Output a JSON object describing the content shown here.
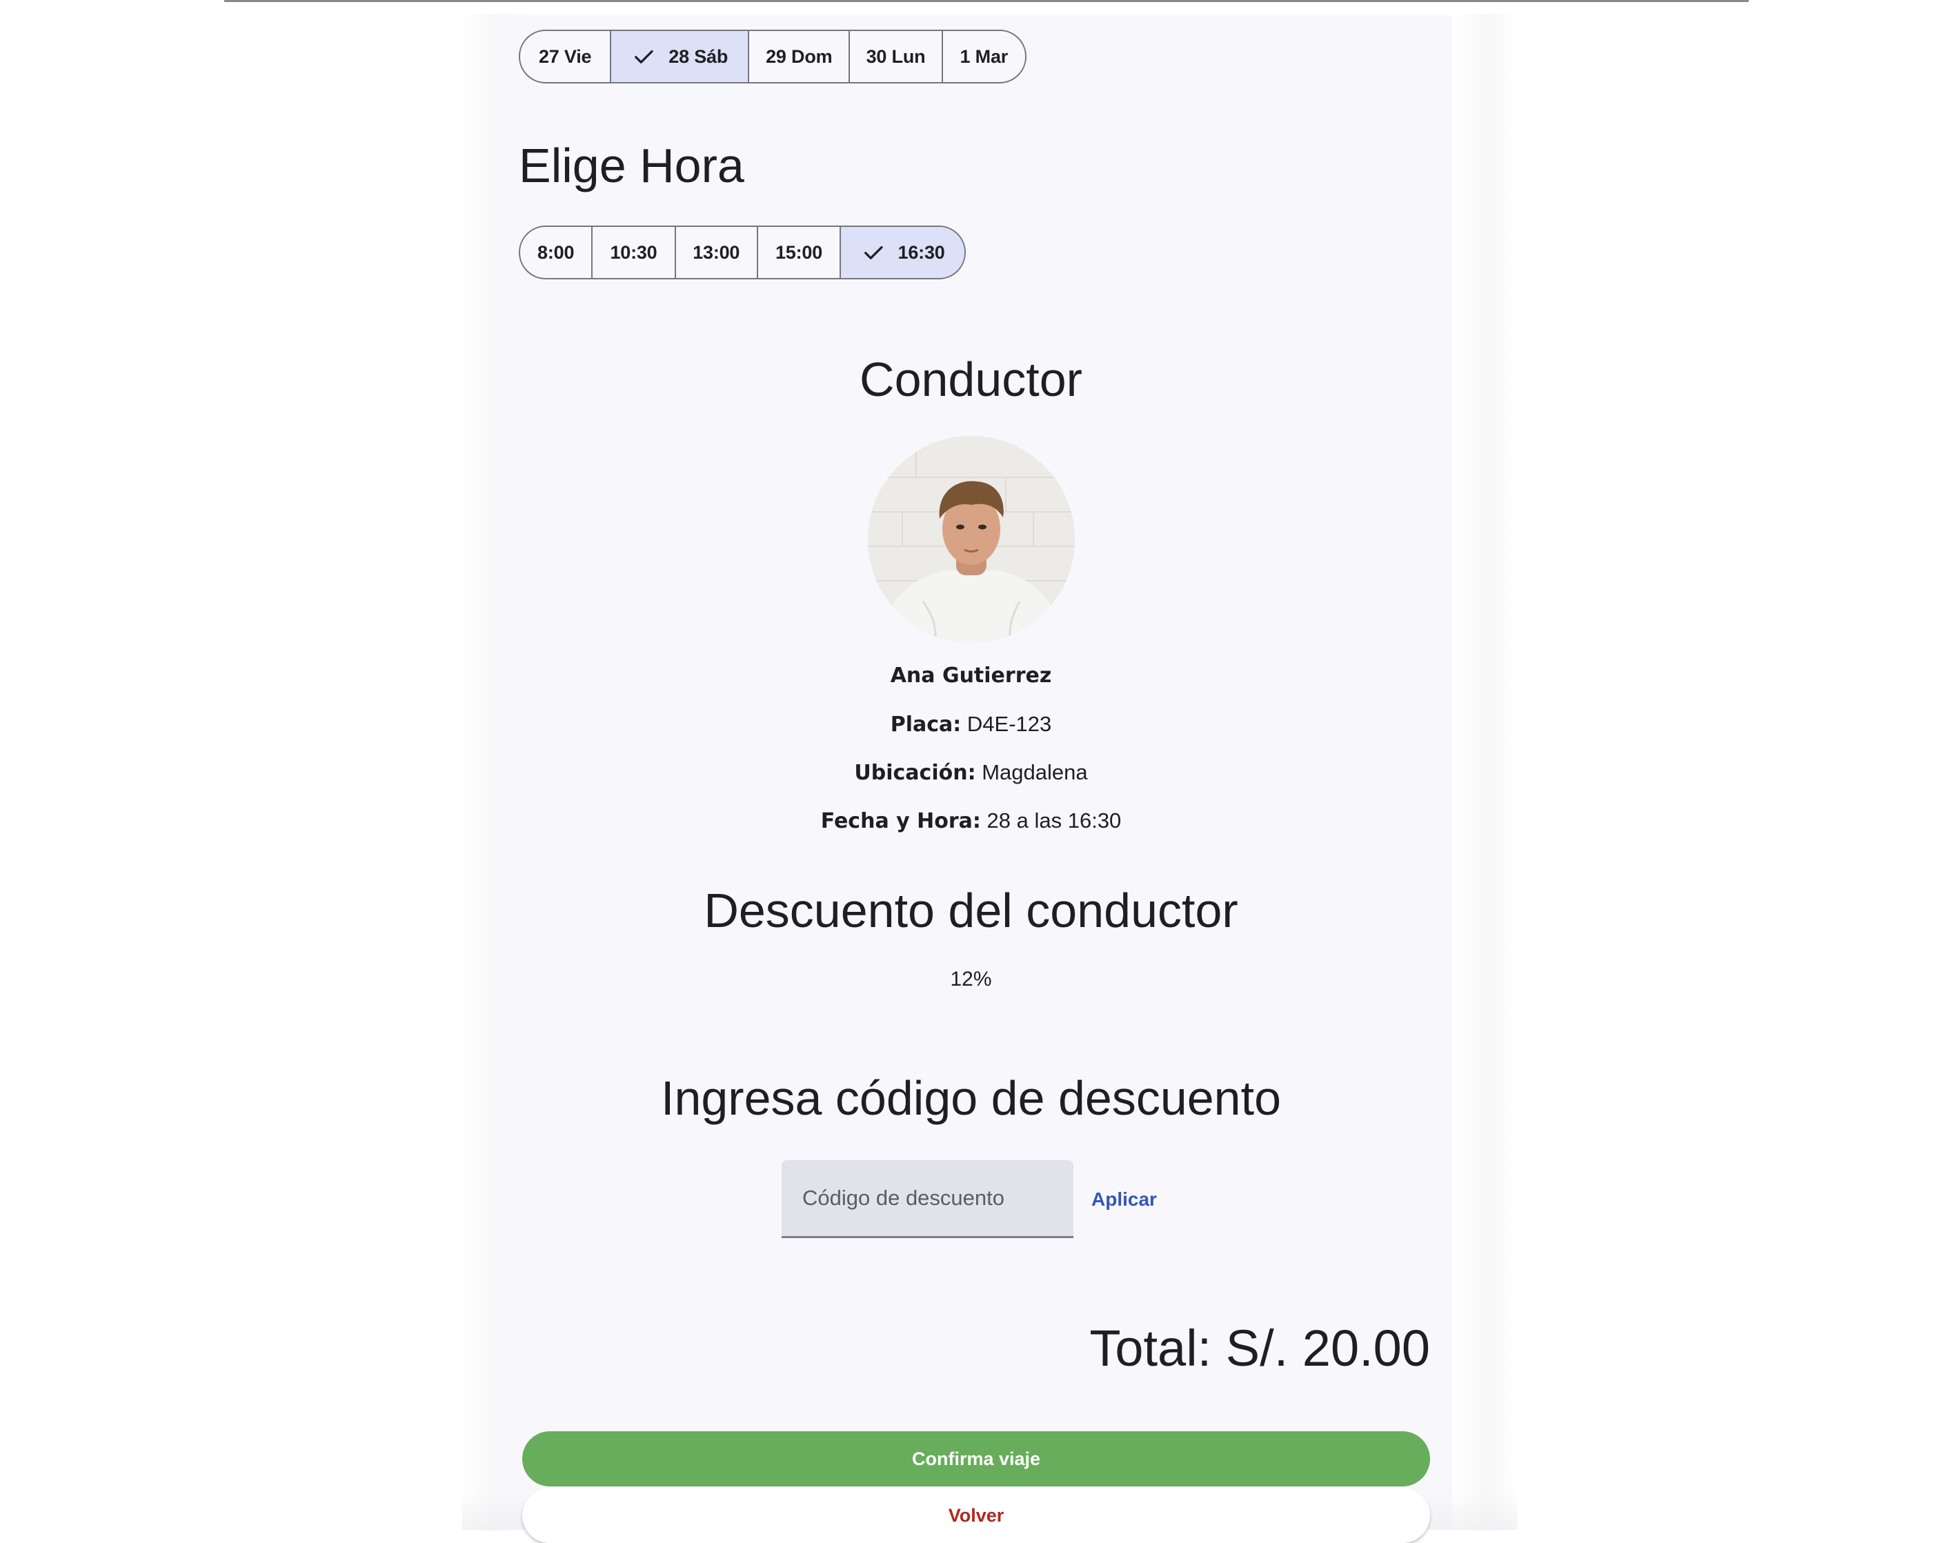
{
  "dates": {
    "items": [
      {
        "label": "27 Vie",
        "selected": false
      },
      {
        "label": "28 Sáb",
        "selected": true
      },
      {
        "label": "29 Dom",
        "selected": false
      },
      {
        "label": "30 Lun",
        "selected": false
      },
      {
        "label": "1 Mar",
        "selected": false
      }
    ]
  },
  "time_section": {
    "title": "Elige Hora",
    "items": [
      {
        "label": "8:00",
        "selected": false
      },
      {
        "label": "10:30",
        "selected": false
      },
      {
        "label": "13:00",
        "selected": false
      },
      {
        "label": "15:00",
        "selected": false
      },
      {
        "label": "16:30",
        "selected": true
      }
    ]
  },
  "driver": {
    "title": "Conductor",
    "name": "Ana Gutierrez",
    "plate_label": "Placa:",
    "plate": "D4E-123",
    "location_label": "Ubicación:",
    "location": "Magdalena",
    "datetime_label": "Fecha y Hora:",
    "datetime": "28 a las 16:30"
  },
  "discount": {
    "title": "Descuento del conductor",
    "value": "12%"
  },
  "code": {
    "title": "Ingresa código de descuento",
    "placeholder": "Código de descuento",
    "value": "",
    "apply_label": "Aplicar"
  },
  "total": {
    "label": "Total: S/. 20.00"
  },
  "actions": {
    "confirm_label": "Confirma viaje",
    "back_label": "Volver"
  },
  "colors": {
    "background": "#f8f7fc",
    "selected_segment": "#dde1f7",
    "confirm": "#67ad5b",
    "back_text": "#b3261e",
    "link": "#3356b8"
  },
  "icons": {
    "selected_marker": "check-icon"
  }
}
